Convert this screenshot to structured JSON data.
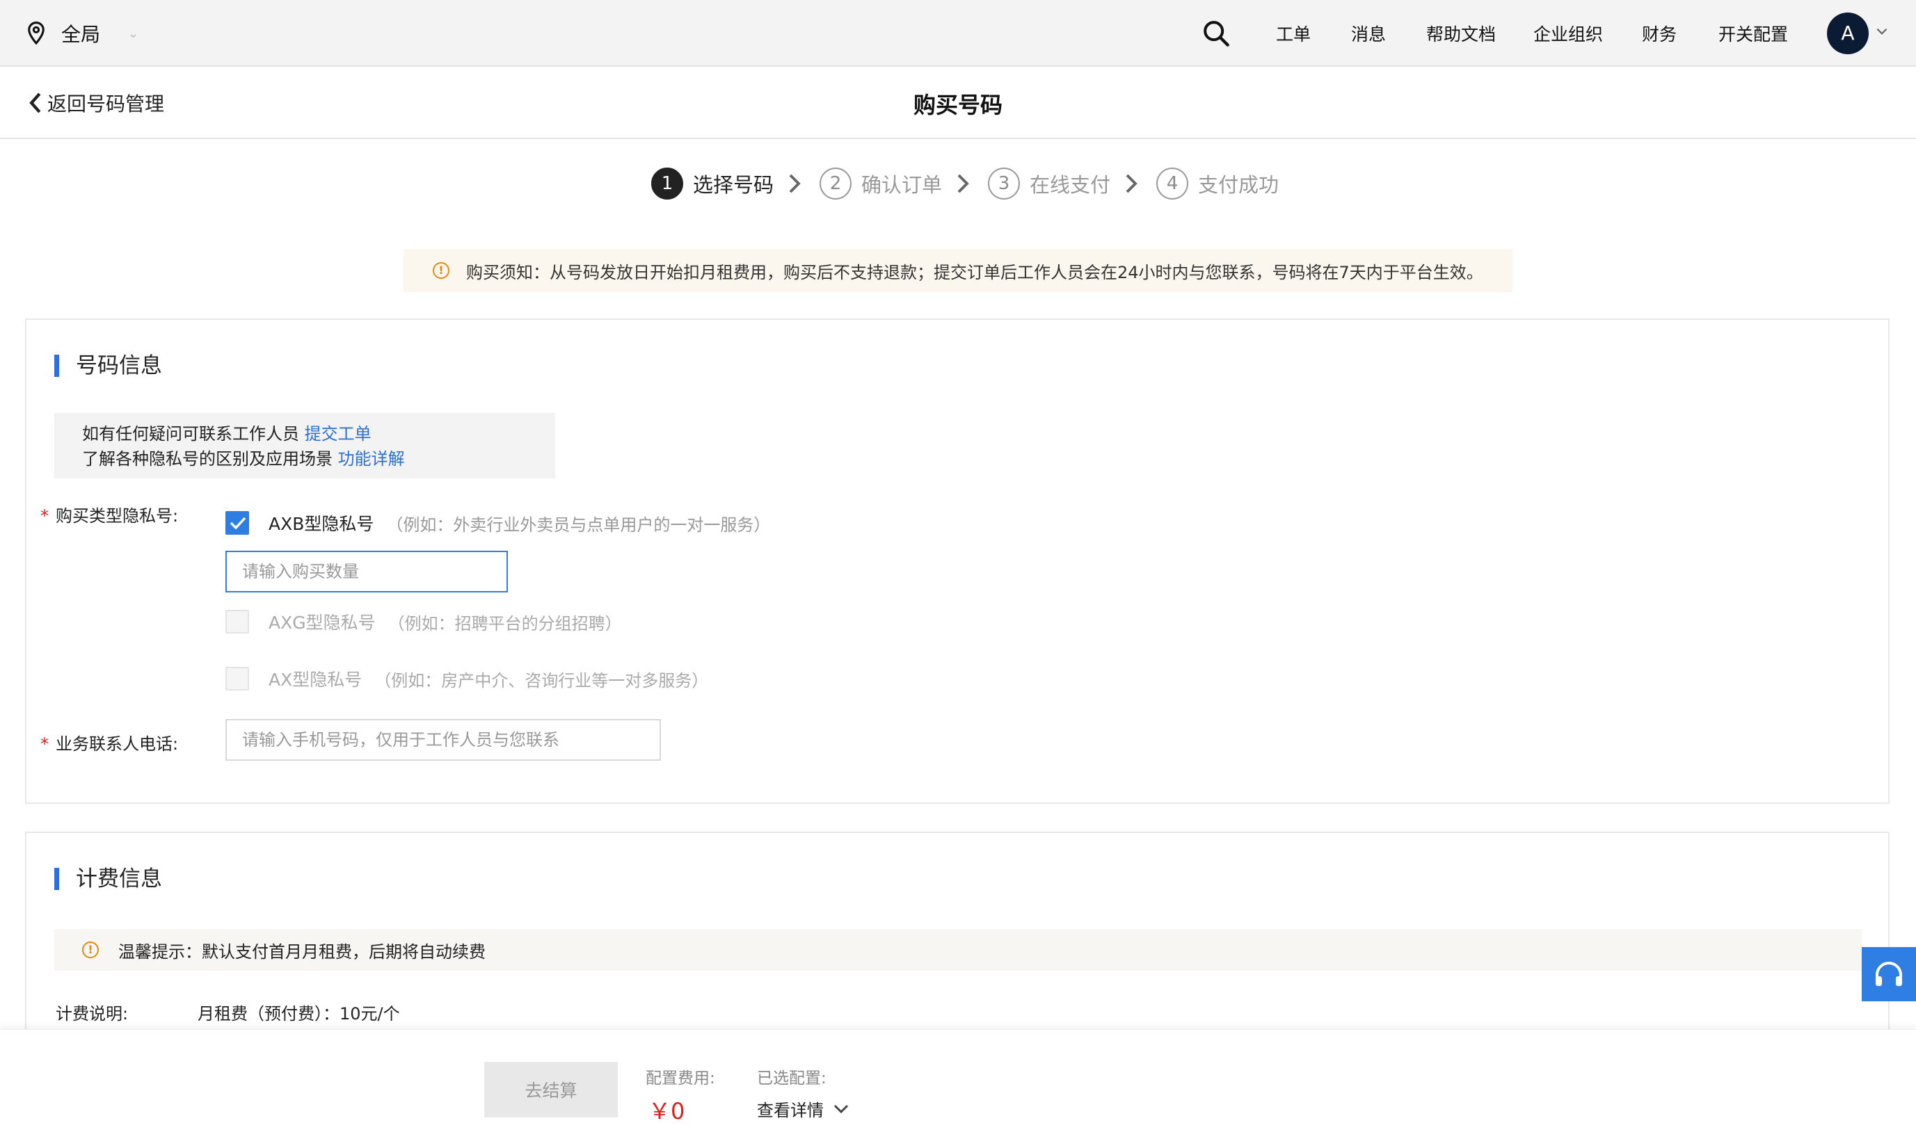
{
  "topbar": {
    "location": "全局",
    "nav": [
      "工单",
      "消息",
      "帮助文档",
      "企业组织",
      "财务",
      "开关配置"
    ],
    "avatar_letter": "A",
    "icons": [
      "location-pin-icon",
      "search-icon",
      "chevron-down-icon"
    ]
  },
  "subhead": {
    "back_label": "返回号码管理",
    "title": "购买号码"
  },
  "steps": [
    {
      "num": "1",
      "label": "选择号码",
      "active": true
    },
    {
      "num": "2",
      "label": "确认订单",
      "active": false
    },
    {
      "num": "3",
      "label": "在线支付",
      "active": false
    },
    {
      "num": "4",
      "label": "支付成功",
      "active": false
    }
  ],
  "notice": "购买须知：从号码发放日开始扣月租费用，购买后不支持退款；提交订单后工作人员会在24小时内与您联系，号码将在7天内于平台生效。",
  "number_info": {
    "title": "号码信息",
    "tip_line1": "如有任何疑问可联系工作人员",
    "tip_link1": "提交工单",
    "tip_line2": "了解各种隐私号的区别及应用场景",
    "tip_link2": "功能详解",
    "type_label": "购买类型隐私号:",
    "options": [
      {
        "label": "AXB型隐私号",
        "hint": "（例如：外卖行业外卖员与点单用户的一对一服务）",
        "checked": true,
        "disabled": false
      },
      {
        "label": "AXG型隐私号",
        "hint": "（例如：招聘平台的分组招聘）",
        "checked": false,
        "disabled": true
      },
      {
        "label": "AX型隐私号",
        "hint": "（例如：房产中介、咨询行业等一对多服务）",
        "checked": false,
        "disabled": true
      }
    ],
    "quantity_placeholder": "请输入购买数量",
    "phone_label": "业务联系人电话:",
    "phone_placeholder": "请输入手机号码，仅用于工作人员与您联系"
  },
  "billing": {
    "title": "计费信息",
    "warm_tip": "温馨提示：默认支付首月月租费，后期将自动续费",
    "fee_label": "计费说明:",
    "fee_value": "月租费（预付费）：10元/个"
  },
  "footer": {
    "checkout": "去结算",
    "cost_label": "配置费用:",
    "price": "￥0",
    "selected_label": "已选配置:",
    "detail_label": "查看详情"
  },
  "colors": {
    "accent": "#2e7de0",
    "price": "#e01e1e",
    "warning": "#e38a10"
  }
}
